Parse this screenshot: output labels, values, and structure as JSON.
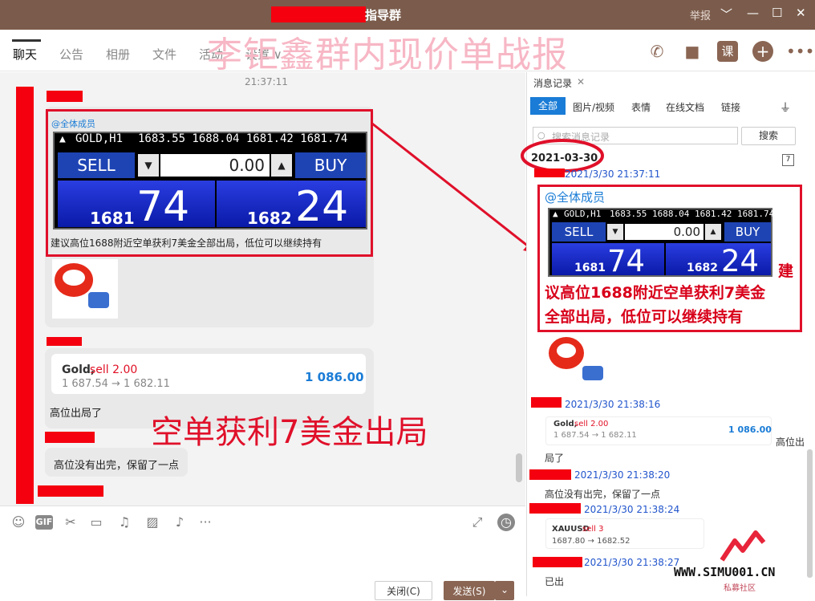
{
  "window": {
    "title": "指导群",
    "report": "举报",
    "min": "﹀",
    "restore": "—",
    "max": "☐",
    "close": "✕"
  },
  "tabs": [
    {
      "label": "聊天"
    },
    {
      "label": "公告"
    },
    {
      "label": "相册"
    },
    {
      "label": "文件"
    },
    {
      "label": "活动"
    },
    {
      "label": "设置 ∨"
    }
  ],
  "watermark": "李钜鑫群内现价单战报",
  "chat": {
    "time": "21:37:11",
    "mention": "@全体成员",
    "widget": {
      "symbol": "GOLD,H1",
      "quote": "1683.55 1688.04 1681.42 1681.74",
      "sell": "SELL",
      "buy": "BUY",
      "volume": "0.00",
      "sell_small": "1681",
      "sell_big": "74",
      "buy_small": "1682",
      "buy_big": "24"
    },
    "msg1_text": "建议高位1688附近空单获利7美金全部出局，低位可以继续持有",
    "trade_card": {
      "symbol": "Gold,",
      "side": "sell 2.00",
      "prices": "1 687.54 → 1 682.11",
      "profit": "1 086.00"
    },
    "msg2_text": "高位出局了",
    "overlay_text": "空单获利7美金出局",
    "msg3_text": "高位没有出完，保留了一点"
  },
  "input": {
    "close_btn": "关闭(C)",
    "send_btn": "发送(S)",
    "send_arrow": "⌄"
  },
  "side": {
    "tab_title": "消息记录",
    "tab_close": "✕",
    "filters": [
      "全部",
      "图片/视频",
      "表情",
      "在线文档",
      "链接"
    ],
    "search_placeholder": "搜索消息记录",
    "search_btn": "搜索",
    "date": "2021-03-30",
    "cal_day": "7",
    "m1_time": "2021/3/30 21:37:11",
    "m1_mention": "@全体成员",
    "m1_red_text": "建议高位1688附近空单获利7美金全部出局，低位可以继续持有",
    "m1_red_first": "建",
    "m1_red_rest1": "议高位1688附近空单获利7美金",
    "m1_red_rest2": "全部出局，低位可以继续持有",
    "m2_time": "2021/3/30 21:38:16",
    "m2_card": {
      "symbol": "Gold,",
      "side": "sell 2.00",
      "prices": "1 687.54 → 1 682.11",
      "profit": "1 086.00"
    },
    "m2_text_a": "高位出",
    "m2_text_b": "局了",
    "m3_time": "2021/3/30 21:38:20",
    "m3_text": "高位没有出完，保留了一点",
    "m4_time": "2021/3/30 21:38:24",
    "m4_card": {
      "symbol": "XAUUSD",
      "side": "sell 3",
      "prices": "1687.80 → 1682.52"
    },
    "m5_time": "2021/3/30 21:38:27",
    "m5_text": "已出"
  },
  "logo": {
    "text": "WWW.SIMU001.CN",
    "sub": "私募社区"
  },
  "colors": {
    "titlebar": "#7b5c4c",
    "accent_red": "#e0102a",
    "blue": "#1a7cd6"
  }
}
